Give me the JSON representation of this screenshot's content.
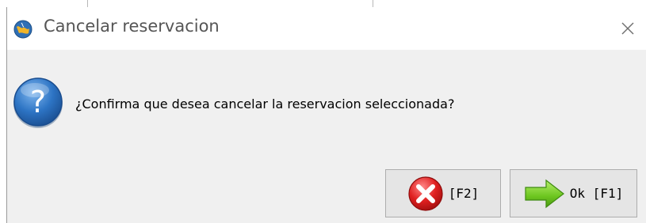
{
  "window": {
    "title": "Cancelar reservacion",
    "app_icon": "globe-app-icon",
    "close_icon": "close-icon"
  },
  "dialog": {
    "icon": "question-icon",
    "message": "¿Confirma que desea cancelar la reservacion seleccionada?"
  },
  "buttons": {
    "cancel": {
      "label": "[F2]",
      "icon": "red-x-icon"
    },
    "ok": {
      "label": "Ok [F1]",
      "icon": "green-arrow-icon"
    }
  },
  "colors": {
    "dialog_bg": "#f0f0f0",
    "titlebar_bg": "#ffffff",
    "button_bg": "#e5e5e5",
    "question_blue": "#2a6fc0",
    "cancel_red": "#e02020",
    "ok_green": "#7cd12a"
  }
}
